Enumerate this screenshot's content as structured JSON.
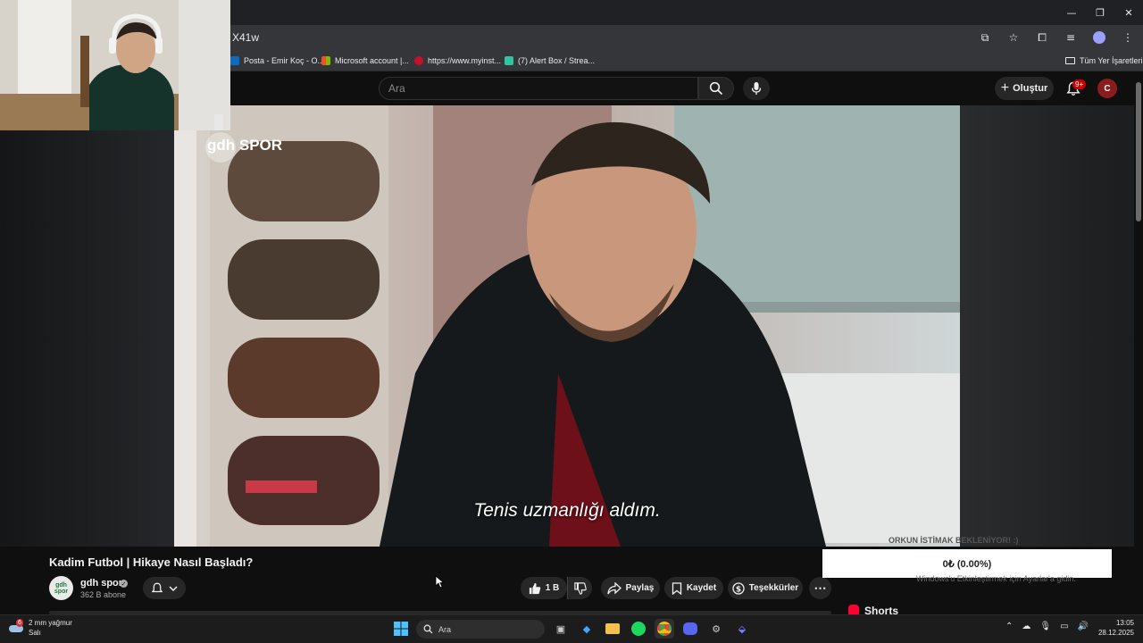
{
  "browser": {
    "url_fragment": "X41w",
    "bookmarks": [
      {
        "label": "Posta - Emir Koç - O...",
        "color": "#0f6cbd"
      },
      {
        "label": "Microsoft account |...",
        "color": "#f25022"
      },
      {
        "label": "https://www.myinst...",
        "color": "#c8102e"
      },
      {
        "label": "(7) Alert Box / Strea...",
        "color": "#31c3a2"
      }
    ],
    "all_bookmarks_label": "Tüm Yer İşaretleri"
  },
  "youtube": {
    "search_placeholder": "Ara",
    "create_label": "Oluştur",
    "notifications_badge": "9+",
    "avatar_letter": "C"
  },
  "video": {
    "watermark": "gdh SPOR",
    "subtitle": "Tenis uzmanlığı aldım.",
    "title": "Kadim Futbol | Hikaye Nasıl Başladı?"
  },
  "channel": {
    "logo_text": "gdh spor",
    "name": "gdh spor",
    "subscribers": "362 B abone"
  },
  "actions": {
    "likes": "1 B",
    "share": "Paylaş",
    "save": "Kaydet",
    "thanks": "Teşekkürler"
  },
  "donation": {
    "header": "ORKUN İSTİMAK BEKLENİYOR! :)",
    "amount": "0₺ (0.00%)",
    "faint_text": "Windows'u Etkinleştirmek için Ayarlar'a gidin."
  },
  "shorts_label": "Shorts",
  "taskbar": {
    "weather_badge": "6",
    "weather_line1": "2 mm yağmur",
    "weather_line2": "Salı",
    "search_placeholder": "Ara",
    "time": "13:05",
    "date": "28.12.2025"
  }
}
